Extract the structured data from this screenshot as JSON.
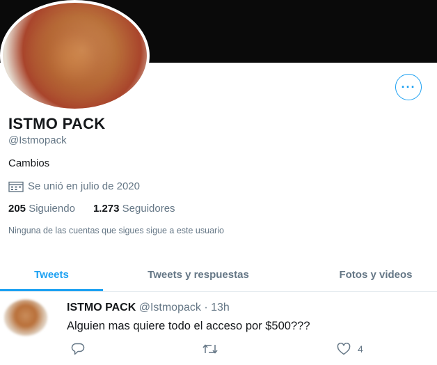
{
  "profile": {
    "name": "ISTMO PACK",
    "handle": "@Istmopack",
    "bio": "Cambios",
    "joined": "Se unió en julio de 2020",
    "following_count": "205",
    "following_label": "Siguiendo",
    "followers_count": "1.273",
    "followers_label": "Seguidores",
    "mutual_note": "Ninguna de las cuentas que sigues sigue a este usuario"
  },
  "more_button": "···",
  "tabs": [
    {
      "label": "Tweets",
      "active": true
    },
    {
      "label": "Tweets y respuestas",
      "active": false
    },
    {
      "label": "Fotos y videos",
      "active": false
    }
  ],
  "tweet": {
    "name": "ISTMO PACK",
    "handle_time": "@Istmopack · 13h",
    "text": "Alguien mas quiere todo el acceso por $500???",
    "like_count": "4"
  },
  "colors": {
    "accent": "#1da1f2",
    "banner": "#0a0a0a",
    "secondary_text": "#657786"
  },
  "icons": [
    "more-icon",
    "calendar-icon",
    "reply-icon",
    "retweet-icon",
    "like-icon"
  ]
}
